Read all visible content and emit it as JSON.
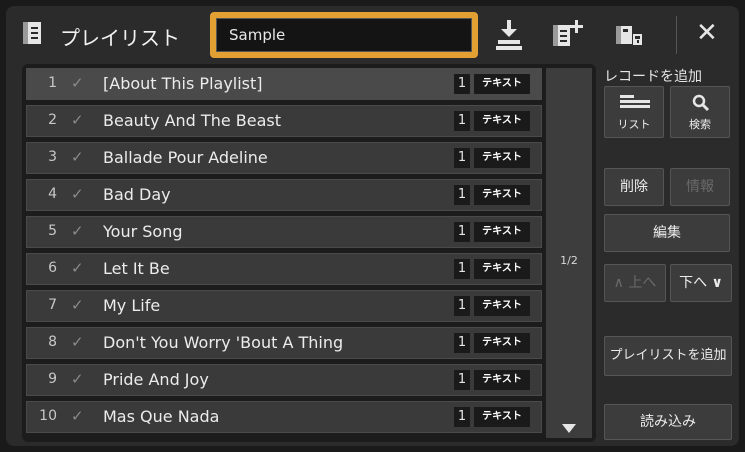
{
  "header": {
    "title": "プレイリスト",
    "playlist_name": "Sample",
    "icons": [
      "playlist-icon",
      "save-icon",
      "new-playlist-icon",
      "registration-icon",
      "close-icon"
    ]
  },
  "songs": [
    {
      "num": "1",
      "name": "[About This Playlist]",
      "count": "1",
      "tag": "テキスト"
    },
    {
      "num": "2",
      "name": "Beauty And The Beast",
      "count": "1",
      "tag": "テキスト"
    },
    {
      "num": "3",
      "name": "Ballade Pour Adeline",
      "count": "1",
      "tag": "テキスト"
    },
    {
      "num": "4",
      "name": "Bad Day",
      "count": "1",
      "tag": "テキスト"
    },
    {
      "num": "5",
      "name": "Your Song",
      "count": "1",
      "tag": "テキスト"
    },
    {
      "num": "6",
      "name": "Let It Be",
      "count": "1",
      "tag": "テキスト"
    },
    {
      "num": "7",
      "name": "My Life",
      "count": "1",
      "tag": "テキスト"
    },
    {
      "num": "8",
      "name": "Don't You Worry 'Bout A Thing",
      "count": "1",
      "tag": "テキスト"
    },
    {
      "num": "9",
      "name": "Pride And Joy",
      "count": "1",
      "tag": "テキスト"
    },
    {
      "num": "10",
      "name": "Mas Que Nada",
      "count": "1",
      "tag": "テキスト"
    }
  ],
  "check_mark": "✓",
  "page_indicator": "1/2",
  "side": {
    "add_record_label": "レコードを追加",
    "list_label": "リスト",
    "search_label": "検索",
    "delete_label": "削除",
    "info_label": "情報",
    "edit_label": "編集",
    "up_label": "上へ",
    "down_label": "下へ",
    "add_playlist_label": "プレイリストを追加",
    "load_label": "読み込み"
  },
  "colors": {
    "accent": "#e2a033",
    "background": "#2b2b2b",
    "row": "#3a3a3a"
  }
}
